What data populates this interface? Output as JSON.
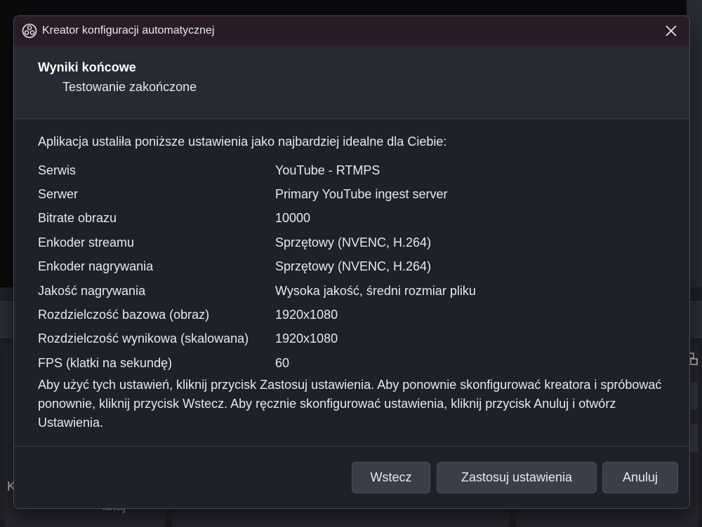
{
  "background": {
    "partial_text_k": "K",
    "partial_text_tutaj": "tutaj"
  },
  "dialog": {
    "title": "Kreator konfiguracji automatycznej",
    "app_icon": "obs-logo-icon",
    "close_icon": "close-icon",
    "header": {
      "title": "Wyniki końcowe",
      "subtitle": "Testowanie zakończone"
    },
    "intro": "Aplikacja ustaliła poniższe ustawienia jako najbardziej idealne dla Ciebie:",
    "settings": [
      {
        "label": "Serwis",
        "value": "YouTube - RTMPS"
      },
      {
        "label": "Serwer",
        "value": "Primary YouTube ingest server"
      },
      {
        "label": "Bitrate obrazu",
        "value": "10000"
      },
      {
        "label": "Enkoder streamu",
        "value": "Sprzętowy (NVENC, H.264)"
      },
      {
        "label": "Enkoder nagrywania",
        "value": "Sprzętowy (NVENC, H.264)"
      },
      {
        "label": "Jakość nagrywania",
        "value": "Wysoka jakość, średni rozmiar pliku"
      },
      {
        "label": "Rozdzielczość bazowa (obraz)",
        "value": "1920x1080"
      },
      {
        "label": "Rozdzielczość wynikowa (skalowana)",
        "value": "1920x1080"
      },
      {
        "label": "FPS (klatki na sekundę)",
        "value": "60"
      }
    ],
    "footer_text": "Aby użyć tych ustawień, kliknij przycisk Zastosuj ustawienia. Aby ponownie skonfigurować kreatora i spróbować ponownie, kliknij przycisk Wstecz. Aby ręcznie skonfigurować ustawienia, kliknij przycisk Anuluj i otwórz Ustawienia.",
    "buttons": {
      "back": "Wstecz",
      "apply": "Zastosuj ustawienia",
      "cancel": "Anuluj"
    }
  }
}
